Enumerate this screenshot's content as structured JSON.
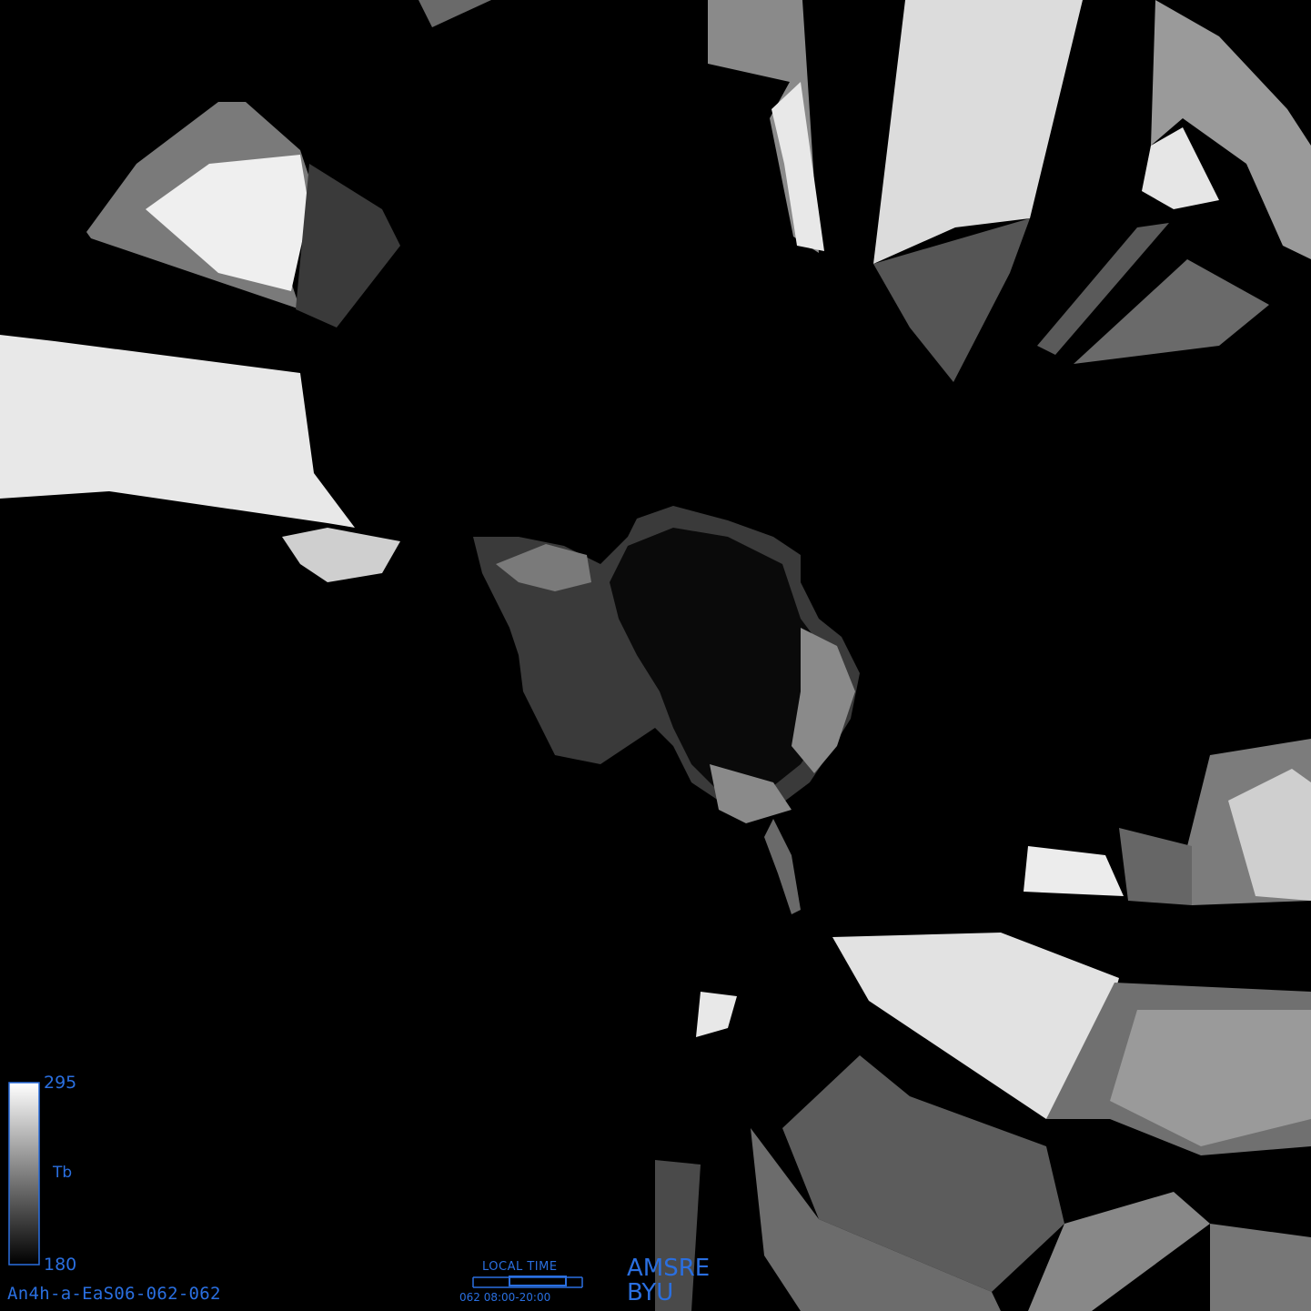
{
  "colorbar": {
    "max": "295",
    "min": "180",
    "unit": "Tb"
  },
  "image_id": "An4h-a-EaS06-062-062",
  "local_time": {
    "title": "LOCAL TIME",
    "range": "062  08:00-20:00"
  },
  "sensor": "AMSRE",
  "org": "BYU",
  "colors": {
    "label_blue": "#2a6fe0",
    "background": "#000000"
  }
}
